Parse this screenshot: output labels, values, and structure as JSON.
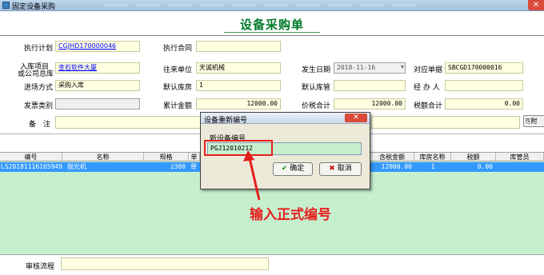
{
  "window": {
    "title": "固定设备采购",
    "close_glyph": "✕"
  },
  "heading": "设备采购单",
  "form": {
    "plan_label": "执行计划",
    "plan_value": "CGJHD170000046",
    "contract_label": "执行合同",
    "contract_value": "",
    "dept_label_line1": "入库项目",
    "dept_label_line2": "或公司总库",
    "dept_value": "金石软件大厦",
    "partner_label": "往来单位",
    "partner_value": "天诚机械",
    "date_label": "发生日期",
    "date_value": "2018-11-16",
    "related_label": "对应单据",
    "related_value": "SBCGD170000016",
    "method_label": "进场方式",
    "method_value": "采购入库",
    "default_ws_label": "默认库房",
    "default_ws_value": "1",
    "default_mgr_label": "默认库管",
    "default_mgr_value": "",
    "handler_label": "经 办 人",
    "handler_value": "",
    "invoice_label": "发票类别",
    "invoice_value": "",
    "total_label": "累计金额",
    "total_value": "12000.00",
    "taxed_total_label": "价税合计",
    "taxed_total_value": "12000.00",
    "tax_total_label": "税额合计",
    "tax_total_value": "0.00",
    "remark_label": "备　注",
    "attach_label": "附"
  },
  "grid": {
    "headers": [
      "编号",
      "名称",
      "规格",
      "单",
      "含税金额",
      "库房名称",
      "税额",
      "库管员"
    ],
    "rows": [
      {
        "code": "LS2018111616594904",
        "name": "抛光机",
        "spec": "z300",
        "unit": "单",
        "amount": "12000.00",
        "warehouse": "1",
        "tax": "0.00",
        "keeper": ""
      }
    ]
  },
  "workflow_label": "审核流程",
  "dialog": {
    "title": "设备重新编号",
    "close_glyph": "✕",
    "field_label": "新设备编号",
    "field_value": "PGJ12010212",
    "ok_label": "确定",
    "ok_glyph": "✔",
    "cancel_label": "取消",
    "cancel_glyph": "✖"
  },
  "annotation": "输入正式编号",
  "colors": {
    "accent_red": "#e61e1e",
    "heading_green": "#007a28",
    "grid_green": "#c6efce",
    "selected_row": "#3399ff"
  }
}
